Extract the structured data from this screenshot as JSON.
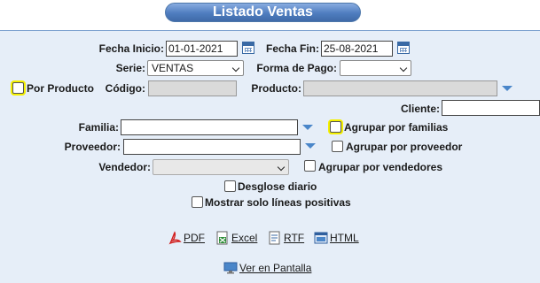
{
  "title": "Listado Ventas",
  "fields": {
    "fecha_inicio_label": "Fecha Inicio:",
    "fecha_inicio_value": "01-01-2021",
    "fecha_fin_label": "Fecha Fin:",
    "fecha_fin_value": "25-08-2021",
    "serie_label": "Serie:",
    "serie_value": "VENTAS",
    "forma_pago_label": "Forma de Pago:",
    "forma_pago_value": "",
    "por_producto_label": "Por Producto",
    "codigo_label": "Código:",
    "codigo_value": "",
    "producto_label": "Producto:",
    "producto_value": "",
    "cliente_label": "Cliente:",
    "cliente_value": "",
    "familia_label": "Familia:",
    "familia_value": "",
    "agrupar_familias_label": "Agrupar por familias",
    "proveedor_label": "Proveedor:",
    "proveedor_value": "",
    "agrupar_proveedor_label": "Agrupar por proveedor",
    "vendedor_label": "Vendedor:",
    "vendedor_value": "",
    "agrupar_vendedores_label": "Agrupar por vendedores",
    "desglose_label": "Desglose diario",
    "mostrar_positivas_label": "Mostrar solo líneas positivas"
  },
  "exports": {
    "pdf": "PDF",
    "excel": "Excel",
    "rtf": "RTF",
    "html": "HTML",
    "pantalla": "Ver en Pantalla"
  },
  "colors": {
    "title_bar": "#4f7dbf",
    "panel_bg": "#e6eef8",
    "highlight": "#f4f000",
    "dropdown_arrow": "#4a86c9"
  }
}
